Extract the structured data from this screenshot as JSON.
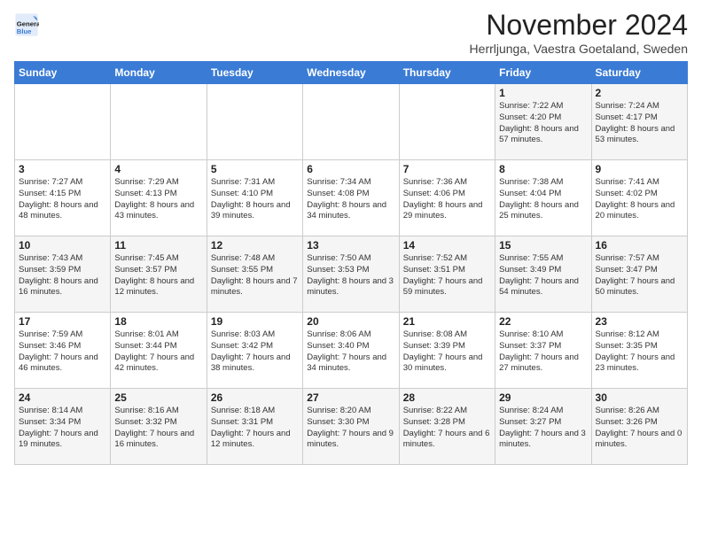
{
  "header": {
    "logo_line1": "General",
    "logo_line2": "Blue",
    "month": "November 2024",
    "location": "Herrljunga, Vaestra Goetaland, Sweden"
  },
  "weekdays": [
    "Sunday",
    "Monday",
    "Tuesday",
    "Wednesday",
    "Thursday",
    "Friday",
    "Saturday"
  ],
  "weeks": [
    [
      {
        "day": "",
        "info": ""
      },
      {
        "day": "",
        "info": ""
      },
      {
        "day": "",
        "info": ""
      },
      {
        "day": "",
        "info": ""
      },
      {
        "day": "",
        "info": ""
      },
      {
        "day": "1",
        "info": "Sunrise: 7:22 AM\nSunset: 4:20 PM\nDaylight: 8 hours and 57 minutes."
      },
      {
        "day": "2",
        "info": "Sunrise: 7:24 AM\nSunset: 4:17 PM\nDaylight: 8 hours and 53 minutes."
      }
    ],
    [
      {
        "day": "3",
        "info": "Sunrise: 7:27 AM\nSunset: 4:15 PM\nDaylight: 8 hours and 48 minutes."
      },
      {
        "day": "4",
        "info": "Sunrise: 7:29 AM\nSunset: 4:13 PM\nDaylight: 8 hours and 43 minutes."
      },
      {
        "day": "5",
        "info": "Sunrise: 7:31 AM\nSunset: 4:10 PM\nDaylight: 8 hours and 39 minutes."
      },
      {
        "day": "6",
        "info": "Sunrise: 7:34 AM\nSunset: 4:08 PM\nDaylight: 8 hours and 34 minutes."
      },
      {
        "day": "7",
        "info": "Sunrise: 7:36 AM\nSunset: 4:06 PM\nDaylight: 8 hours and 29 minutes."
      },
      {
        "day": "8",
        "info": "Sunrise: 7:38 AM\nSunset: 4:04 PM\nDaylight: 8 hours and 25 minutes."
      },
      {
        "day": "9",
        "info": "Sunrise: 7:41 AM\nSunset: 4:02 PM\nDaylight: 8 hours and 20 minutes."
      }
    ],
    [
      {
        "day": "10",
        "info": "Sunrise: 7:43 AM\nSunset: 3:59 PM\nDaylight: 8 hours and 16 minutes."
      },
      {
        "day": "11",
        "info": "Sunrise: 7:45 AM\nSunset: 3:57 PM\nDaylight: 8 hours and 12 minutes."
      },
      {
        "day": "12",
        "info": "Sunrise: 7:48 AM\nSunset: 3:55 PM\nDaylight: 8 hours and 7 minutes."
      },
      {
        "day": "13",
        "info": "Sunrise: 7:50 AM\nSunset: 3:53 PM\nDaylight: 8 hours and 3 minutes."
      },
      {
        "day": "14",
        "info": "Sunrise: 7:52 AM\nSunset: 3:51 PM\nDaylight: 7 hours and 59 minutes."
      },
      {
        "day": "15",
        "info": "Sunrise: 7:55 AM\nSunset: 3:49 PM\nDaylight: 7 hours and 54 minutes."
      },
      {
        "day": "16",
        "info": "Sunrise: 7:57 AM\nSunset: 3:47 PM\nDaylight: 7 hours and 50 minutes."
      }
    ],
    [
      {
        "day": "17",
        "info": "Sunrise: 7:59 AM\nSunset: 3:46 PM\nDaylight: 7 hours and 46 minutes."
      },
      {
        "day": "18",
        "info": "Sunrise: 8:01 AM\nSunset: 3:44 PM\nDaylight: 7 hours and 42 minutes."
      },
      {
        "day": "19",
        "info": "Sunrise: 8:03 AM\nSunset: 3:42 PM\nDaylight: 7 hours and 38 minutes."
      },
      {
        "day": "20",
        "info": "Sunrise: 8:06 AM\nSunset: 3:40 PM\nDaylight: 7 hours and 34 minutes."
      },
      {
        "day": "21",
        "info": "Sunrise: 8:08 AM\nSunset: 3:39 PM\nDaylight: 7 hours and 30 minutes."
      },
      {
        "day": "22",
        "info": "Sunrise: 8:10 AM\nSunset: 3:37 PM\nDaylight: 7 hours and 27 minutes."
      },
      {
        "day": "23",
        "info": "Sunrise: 8:12 AM\nSunset: 3:35 PM\nDaylight: 7 hours and 23 minutes."
      }
    ],
    [
      {
        "day": "24",
        "info": "Sunrise: 8:14 AM\nSunset: 3:34 PM\nDaylight: 7 hours and 19 minutes."
      },
      {
        "day": "25",
        "info": "Sunrise: 8:16 AM\nSunset: 3:32 PM\nDaylight: 7 hours and 16 minutes."
      },
      {
        "day": "26",
        "info": "Sunrise: 8:18 AM\nSunset: 3:31 PM\nDaylight: 7 hours and 12 minutes."
      },
      {
        "day": "27",
        "info": "Sunrise: 8:20 AM\nSunset: 3:30 PM\nDaylight: 7 hours and 9 minutes."
      },
      {
        "day": "28",
        "info": "Sunrise: 8:22 AM\nSunset: 3:28 PM\nDaylight: 7 hours and 6 minutes."
      },
      {
        "day": "29",
        "info": "Sunrise: 8:24 AM\nSunset: 3:27 PM\nDaylight: 7 hours and 3 minutes."
      },
      {
        "day": "30",
        "info": "Sunrise: 8:26 AM\nSunset: 3:26 PM\nDaylight: 7 hours and 0 minutes."
      }
    ]
  ]
}
